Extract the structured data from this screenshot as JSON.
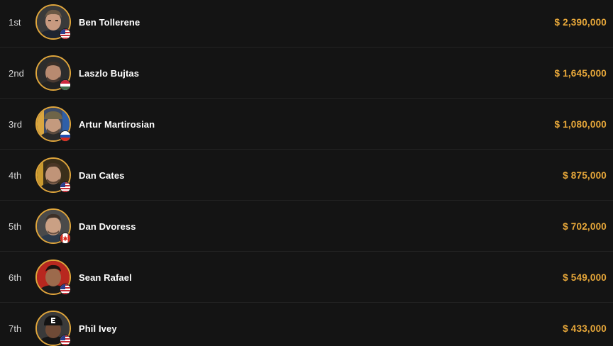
{
  "results": [
    {
      "rank": "1st",
      "name": "Ben Tollerene",
      "prize": "$ 2,390,000",
      "flag": "us",
      "photo": "player-1"
    },
    {
      "rank": "2nd",
      "name": "Laszlo Bujtas",
      "prize": "$ 1,645,000",
      "flag": "hu",
      "photo": "player-2"
    },
    {
      "rank": "3rd",
      "name": "Artur Martirosian",
      "prize": "$ 1,080,000",
      "flag": "ru",
      "photo": "player-3"
    },
    {
      "rank": "4th",
      "name": "Dan Cates",
      "prize": "$ 875,000",
      "flag": "us",
      "photo": "player-4"
    },
    {
      "rank": "5th",
      "name": "Dan Dvoress",
      "prize": "$ 702,000",
      "flag": "ca",
      "photo": "player-5"
    },
    {
      "rank": "6th",
      "name": "Sean Rafael",
      "prize": "$ 549,000",
      "flag": "us",
      "photo": "player-6"
    },
    {
      "rank": "7th",
      "name": "Phil Ivey",
      "prize": "$ 433,000",
      "flag": "us",
      "photo": "player-7"
    }
  ],
  "colors": {
    "background": "#141414",
    "divider": "#232323",
    "accent": "#e8a83a",
    "avatar_ring": "#e0a63c",
    "name": "#ffffff",
    "rank": "#d8d8d8"
  }
}
